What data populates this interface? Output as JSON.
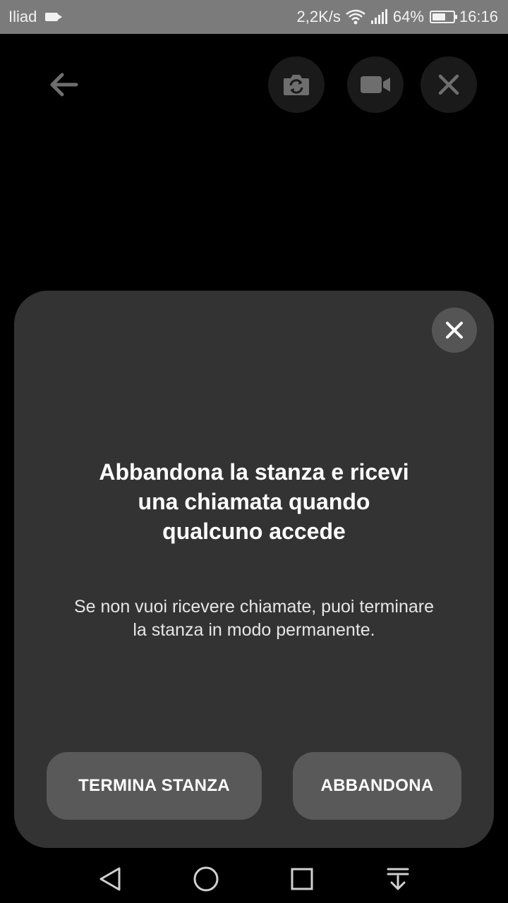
{
  "status_bar": {
    "carrier": "Iliad",
    "network_speed": "2,2K/s",
    "battery_percent": "64%",
    "battery_level": 0.64,
    "time": "16:16"
  },
  "icons": {
    "back": "arrow-left-icon",
    "flip_camera": "camera-flip-icon",
    "video": "video-camera-icon",
    "close": "close-icon"
  },
  "dialog": {
    "title": "Abbandona la stanza e ricevi una chiamata quando qualcuno accede",
    "description": "Se non vuoi ricevere chiamate, puoi terminare la stanza in modo permanente.",
    "end_button_label": "TERMINA STANZA",
    "leave_button_label": "ABBANDONA"
  },
  "colors": {
    "background": "#000000",
    "sheet": "#333333",
    "button": "#595959",
    "status_bar": "#7b7b7b"
  }
}
